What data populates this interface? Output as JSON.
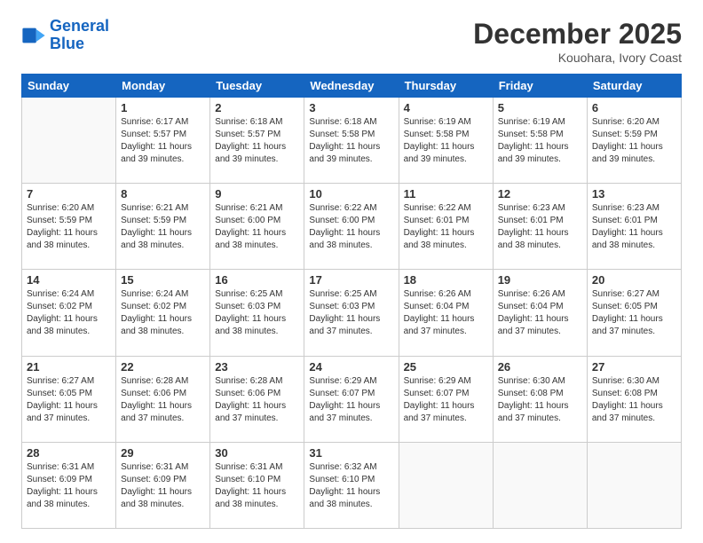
{
  "header": {
    "logo_line1": "General",
    "logo_line2": "Blue",
    "month_title": "December 2025",
    "subtitle": "Kouohara, Ivory Coast"
  },
  "weekdays": [
    "Sunday",
    "Monday",
    "Tuesday",
    "Wednesday",
    "Thursday",
    "Friday",
    "Saturday"
  ],
  "weeks": [
    [
      {
        "day": "",
        "sunrise": "",
        "sunset": "",
        "daylight": "",
        "empty": true
      },
      {
        "day": "1",
        "sunrise": "Sunrise: 6:17 AM",
        "sunset": "Sunset: 5:57 PM",
        "daylight": "Daylight: 11 hours and 39 minutes."
      },
      {
        "day": "2",
        "sunrise": "Sunrise: 6:18 AM",
        "sunset": "Sunset: 5:57 PM",
        "daylight": "Daylight: 11 hours and 39 minutes."
      },
      {
        "day": "3",
        "sunrise": "Sunrise: 6:18 AM",
        "sunset": "Sunset: 5:58 PM",
        "daylight": "Daylight: 11 hours and 39 minutes."
      },
      {
        "day": "4",
        "sunrise": "Sunrise: 6:19 AM",
        "sunset": "Sunset: 5:58 PM",
        "daylight": "Daylight: 11 hours and 39 minutes."
      },
      {
        "day": "5",
        "sunrise": "Sunrise: 6:19 AM",
        "sunset": "Sunset: 5:58 PM",
        "daylight": "Daylight: 11 hours and 39 minutes."
      },
      {
        "day": "6",
        "sunrise": "Sunrise: 6:20 AM",
        "sunset": "Sunset: 5:59 PM",
        "daylight": "Daylight: 11 hours and 39 minutes."
      }
    ],
    [
      {
        "day": "7",
        "sunrise": "Sunrise: 6:20 AM",
        "sunset": "Sunset: 5:59 PM",
        "daylight": "Daylight: 11 hours and 38 minutes."
      },
      {
        "day": "8",
        "sunrise": "Sunrise: 6:21 AM",
        "sunset": "Sunset: 5:59 PM",
        "daylight": "Daylight: 11 hours and 38 minutes."
      },
      {
        "day": "9",
        "sunrise": "Sunrise: 6:21 AM",
        "sunset": "Sunset: 6:00 PM",
        "daylight": "Daylight: 11 hours and 38 minutes."
      },
      {
        "day": "10",
        "sunrise": "Sunrise: 6:22 AM",
        "sunset": "Sunset: 6:00 PM",
        "daylight": "Daylight: 11 hours and 38 minutes."
      },
      {
        "day": "11",
        "sunrise": "Sunrise: 6:22 AM",
        "sunset": "Sunset: 6:01 PM",
        "daylight": "Daylight: 11 hours and 38 minutes."
      },
      {
        "day": "12",
        "sunrise": "Sunrise: 6:23 AM",
        "sunset": "Sunset: 6:01 PM",
        "daylight": "Daylight: 11 hours and 38 minutes."
      },
      {
        "day": "13",
        "sunrise": "Sunrise: 6:23 AM",
        "sunset": "Sunset: 6:01 PM",
        "daylight": "Daylight: 11 hours and 38 minutes."
      }
    ],
    [
      {
        "day": "14",
        "sunrise": "Sunrise: 6:24 AM",
        "sunset": "Sunset: 6:02 PM",
        "daylight": "Daylight: 11 hours and 38 minutes."
      },
      {
        "day": "15",
        "sunrise": "Sunrise: 6:24 AM",
        "sunset": "Sunset: 6:02 PM",
        "daylight": "Daylight: 11 hours and 38 minutes."
      },
      {
        "day": "16",
        "sunrise": "Sunrise: 6:25 AM",
        "sunset": "Sunset: 6:03 PM",
        "daylight": "Daylight: 11 hours and 38 minutes."
      },
      {
        "day": "17",
        "sunrise": "Sunrise: 6:25 AM",
        "sunset": "Sunset: 6:03 PM",
        "daylight": "Daylight: 11 hours and 37 minutes."
      },
      {
        "day": "18",
        "sunrise": "Sunrise: 6:26 AM",
        "sunset": "Sunset: 6:04 PM",
        "daylight": "Daylight: 11 hours and 37 minutes."
      },
      {
        "day": "19",
        "sunrise": "Sunrise: 6:26 AM",
        "sunset": "Sunset: 6:04 PM",
        "daylight": "Daylight: 11 hours and 37 minutes."
      },
      {
        "day": "20",
        "sunrise": "Sunrise: 6:27 AM",
        "sunset": "Sunset: 6:05 PM",
        "daylight": "Daylight: 11 hours and 37 minutes."
      }
    ],
    [
      {
        "day": "21",
        "sunrise": "Sunrise: 6:27 AM",
        "sunset": "Sunset: 6:05 PM",
        "daylight": "Daylight: 11 hours and 37 minutes."
      },
      {
        "day": "22",
        "sunrise": "Sunrise: 6:28 AM",
        "sunset": "Sunset: 6:06 PM",
        "daylight": "Daylight: 11 hours and 37 minutes."
      },
      {
        "day": "23",
        "sunrise": "Sunrise: 6:28 AM",
        "sunset": "Sunset: 6:06 PM",
        "daylight": "Daylight: 11 hours and 37 minutes."
      },
      {
        "day": "24",
        "sunrise": "Sunrise: 6:29 AM",
        "sunset": "Sunset: 6:07 PM",
        "daylight": "Daylight: 11 hours and 37 minutes."
      },
      {
        "day": "25",
        "sunrise": "Sunrise: 6:29 AM",
        "sunset": "Sunset: 6:07 PM",
        "daylight": "Daylight: 11 hours and 37 minutes."
      },
      {
        "day": "26",
        "sunrise": "Sunrise: 6:30 AM",
        "sunset": "Sunset: 6:08 PM",
        "daylight": "Daylight: 11 hours and 37 minutes."
      },
      {
        "day": "27",
        "sunrise": "Sunrise: 6:30 AM",
        "sunset": "Sunset: 6:08 PM",
        "daylight": "Daylight: 11 hours and 37 minutes."
      }
    ],
    [
      {
        "day": "28",
        "sunrise": "Sunrise: 6:31 AM",
        "sunset": "Sunset: 6:09 PM",
        "daylight": "Daylight: 11 hours and 38 minutes."
      },
      {
        "day": "29",
        "sunrise": "Sunrise: 6:31 AM",
        "sunset": "Sunset: 6:09 PM",
        "daylight": "Daylight: 11 hours and 38 minutes."
      },
      {
        "day": "30",
        "sunrise": "Sunrise: 6:31 AM",
        "sunset": "Sunset: 6:10 PM",
        "daylight": "Daylight: 11 hours and 38 minutes."
      },
      {
        "day": "31",
        "sunrise": "Sunrise: 6:32 AM",
        "sunset": "Sunset: 6:10 PM",
        "daylight": "Daylight: 11 hours and 38 minutes."
      },
      {
        "day": "",
        "sunrise": "",
        "sunset": "",
        "daylight": "",
        "empty": true
      },
      {
        "day": "",
        "sunrise": "",
        "sunset": "",
        "daylight": "",
        "empty": true
      },
      {
        "day": "",
        "sunrise": "",
        "sunset": "",
        "daylight": "",
        "empty": true
      }
    ]
  ]
}
